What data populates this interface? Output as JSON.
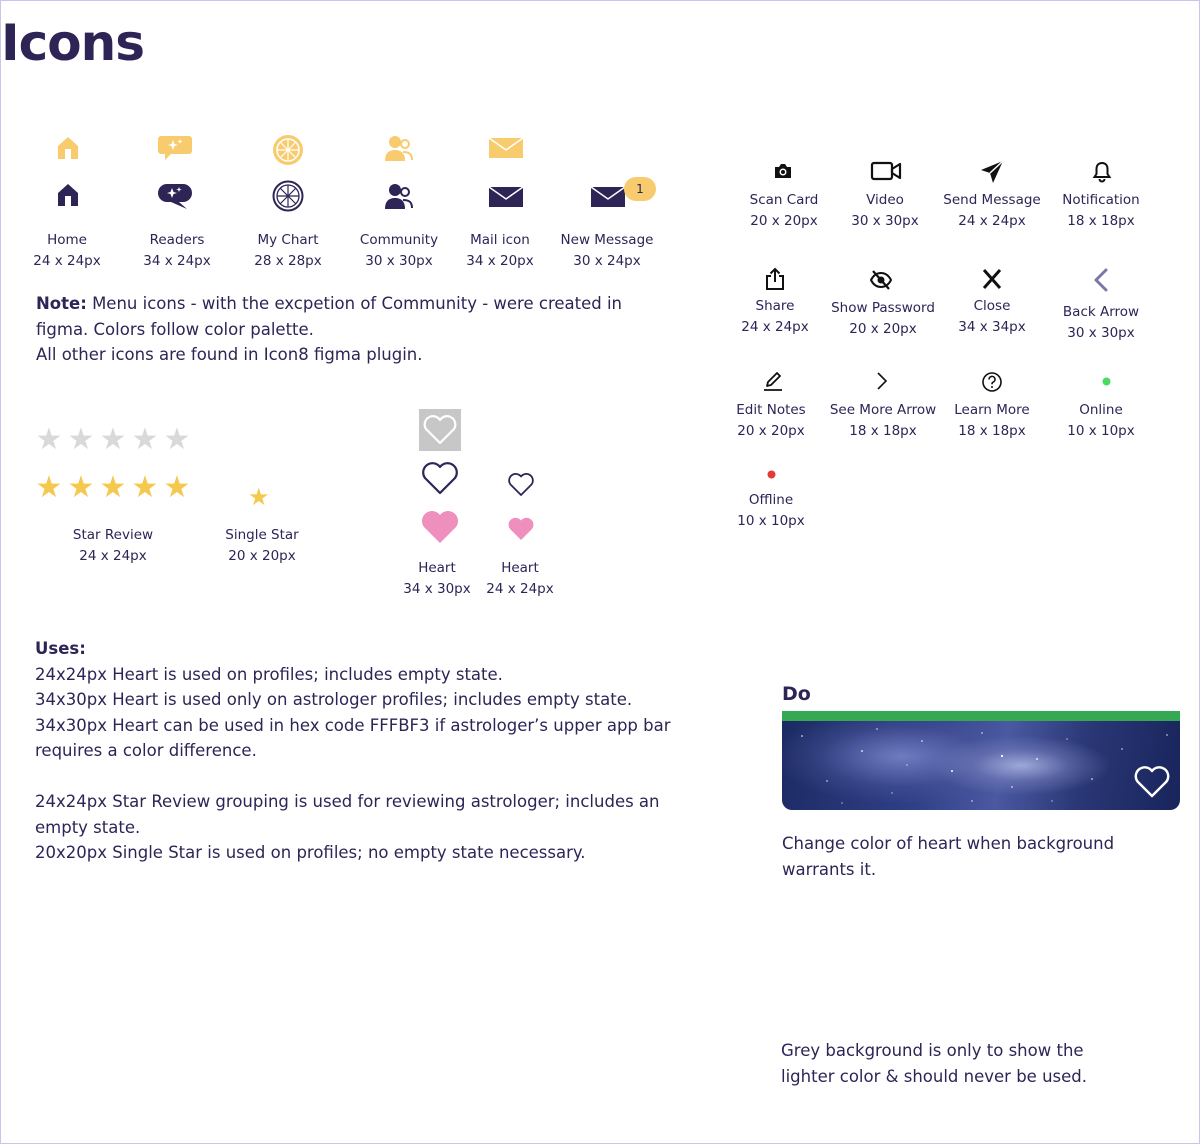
{
  "page": {
    "title": "Icons"
  },
  "menu_icons": [
    {
      "name": "Home",
      "size": "24 x 24px"
    },
    {
      "name": "Readers",
      "size": "34 x 24px"
    },
    {
      "name": "My Chart",
      "size": "28 x 28px"
    },
    {
      "name": "Community",
      "size": "30 x 30px"
    },
    {
      "name": "Mail icon",
      "size": "34 x 20px"
    },
    {
      "name": "New Message",
      "size": "30 x 24px",
      "badge": "1"
    }
  ],
  "note": {
    "label": "Note:",
    "line1": " Menu icons - with the excpetion of Community - were created in",
    "line2": "figma. Colors follow color palette.",
    "line3": "All other icons are found in Icon8 figma plugin."
  },
  "stars": {
    "glyph": "★",
    "review": {
      "name": "Star Review",
      "size": "24 x 24px",
      "count": 5
    },
    "single": {
      "name": "Single Star",
      "size": "20 x 20px"
    }
  },
  "hearts": [
    {
      "name": "Heart",
      "size": "34 x 30px"
    },
    {
      "name": "Heart",
      "size": "24 x 24px"
    }
  ],
  "utility_icons": [
    {
      "name": "Scan Card",
      "size": "20 x 20px",
      "icon": "camera-icon"
    },
    {
      "name": "Video",
      "size": "30 x 30px",
      "icon": "video-icon"
    },
    {
      "name": "Send Message",
      "size": "24 x 24px",
      "icon": "send-icon"
    },
    {
      "name": "Notification",
      "size": "18 x 18px",
      "icon": "bell-icon"
    },
    {
      "name": "Share",
      "size": "24 x 24px",
      "icon": "share-icon"
    },
    {
      "name": "Show Password",
      "size": "20 x 20px",
      "icon": "eye-off-icon"
    },
    {
      "name": "Close",
      "size": "34 x 34px",
      "icon": "close-icon"
    },
    {
      "name": "Back Arrow",
      "size": "30 x 30px",
      "icon": "back-arrow-icon"
    },
    {
      "name": "Edit Notes",
      "size": "20 x 20px",
      "icon": "pencil-icon"
    },
    {
      "name": "See More Arrow",
      "size": "18 x 18px",
      "icon": "chevron-right-icon"
    },
    {
      "name": "Learn More",
      "size": "18 x 18px",
      "icon": "question-icon"
    },
    {
      "name": "Online",
      "size": "10 x 10px",
      "icon": "online-dot-icon"
    },
    {
      "name": "Offline",
      "size": "10 x 10px",
      "icon": "offline-dot-icon"
    }
  ],
  "uses": {
    "title": "Uses:",
    "lines": [
      "24x24px Heart is used on profiles; includes empty state.",
      "34x30px Heart is used only on astrologer profiles; includes empty state.",
      "34x30px Heart can be used in hex code FFFBF3 if astrologer’s upper app bar",
      "requires a color difference.",
      "",
      "24x24px Star Review grouping is used for reviewing astrologer; includes an",
      "empty state.",
      "20x20px Single Star is used on profiles; no empty state necessary."
    ]
  },
  "do_example": {
    "title": "Do",
    "caption_line1": "Change color of heart when background",
    "caption_line2": "warrants it."
  },
  "grey_note": {
    "line1": "Grey background is only to show the",
    "line2": "lighter color & should never be used."
  },
  "colors": {
    "primary": "#2e2456",
    "light_yellow": "#f8cc6e",
    "pink": "#ee8fbe",
    "star_yellow": "#f5c94e",
    "star_grey": "#d9d9d9",
    "green": "#34a853",
    "online": "#4cd964",
    "offline": "#e53935"
  }
}
